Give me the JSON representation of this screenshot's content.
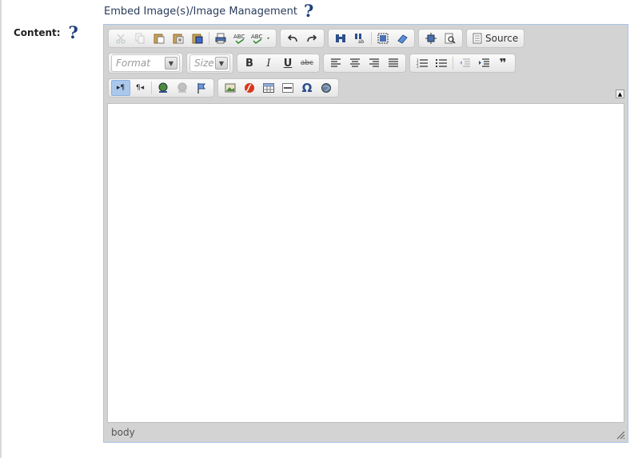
{
  "embed": {
    "link": "Embed Image(s)/Image Management",
    "help": "?"
  },
  "field": {
    "label": "Content:",
    "help": "?"
  },
  "toolbar": {
    "source_label": "Source",
    "format_placeholder": "Format",
    "size_placeholder": "Size"
  },
  "icons": {
    "bold": "B",
    "italic": "I",
    "underline": "U",
    "strike": "abc",
    "omega": "Ω",
    "ltr": "▸¶",
    "rtl": "¶◂",
    "quote": "❞"
  },
  "statusbar": {
    "path": "body"
  },
  "colors": {
    "accent": "#aac4ea",
    "help": "#1e3f7a",
    "link": "#2a3d5c",
    "toolbar_bg": "#d3d3d3"
  }
}
